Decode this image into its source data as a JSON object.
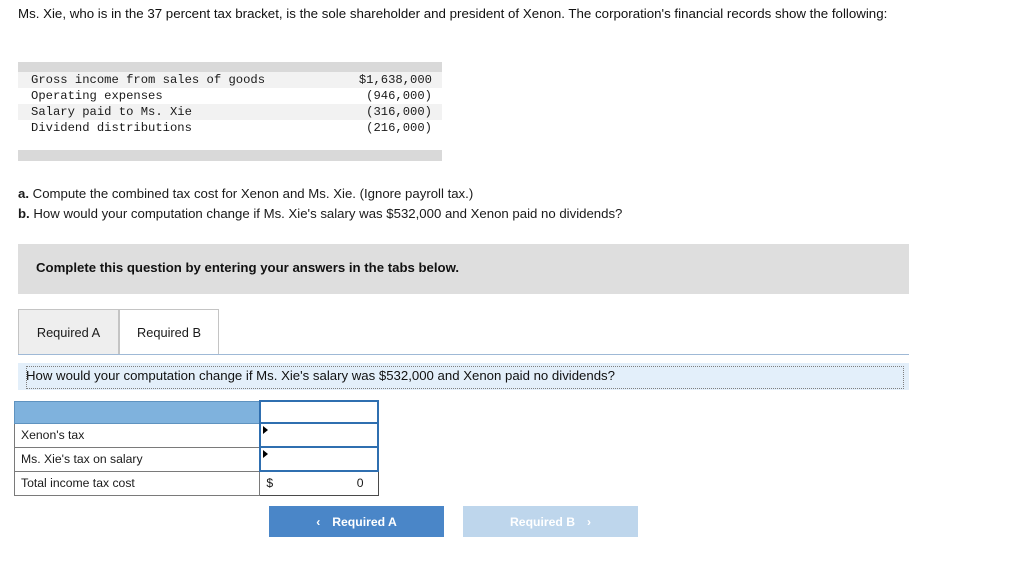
{
  "intro": "Ms. Xie, who is in the 37 percent tax bracket, is the sole shareholder and president of Xenon. The corporation's financial records show the following:",
  "financials": {
    "rows": [
      {
        "label": "Gross income from sales of goods",
        "value": "$1,638,000"
      },
      {
        "label": "Operating expenses",
        "value": "(946,000)"
      },
      {
        "label": "Salary paid to Ms. Xie",
        "value": "(316,000)"
      },
      {
        "label": "Dividend distributions",
        "value": "(216,000)"
      }
    ]
  },
  "questions": {
    "a_label": "a.",
    "a_text": "Compute the combined tax cost for Xenon and Ms. Xie. (Ignore payroll tax.)",
    "b_label": "b.",
    "b_text": "How would your computation change if Ms. Xie's salary was $532,000 and Xenon paid no dividends?"
  },
  "instruction": "Complete this question by entering your answers in the tabs below.",
  "tabs": [
    {
      "label": "Required A",
      "active": false
    },
    {
      "label": "Required B",
      "active": true
    }
  ],
  "question_bar": "How would your computation change if Ms. Xie's salary was $532,000 and Xenon paid no dividends?",
  "answer_table": {
    "header_label": "",
    "header_value": "",
    "rows": [
      {
        "label": "Xenon's tax",
        "value": ""
      },
      {
        "label": "Ms. Xie's tax on salary",
        "value": ""
      }
    ],
    "total": {
      "label": "Total income tax cost",
      "currency": "$",
      "value": "0"
    }
  },
  "nav": {
    "prev_label": "Required A",
    "prev_chevron": "‹",
    "next_label": "Required B",
    "next_chevron": "›"
  }
}
